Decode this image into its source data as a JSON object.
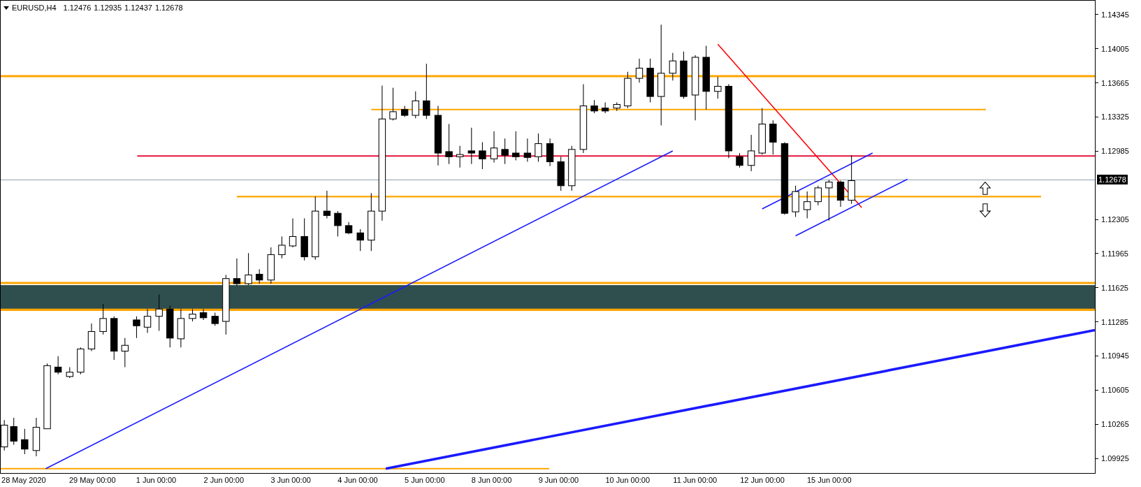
{
  "chart_header": {
    "symbol": "EURUSD,H4",
    "quotes": [
      "1.12476",
      "1.12935",
      "1.12437",
      "1.12678"
    ]
  },
  "price_axis": {
    "labels": [
      "1.14345",
      "1.14005",
      "1.13665",
      "1.13325",
      "1.12985",
      "1.12305",
      "1.11965",
      "1.11625",
      "1.11285",
      "1.10945",
      "1.10605",
      "1.10265",
      "1.09925"
    ],
    "current_price": "1.12678"
  },
  "time_axis": {
    "labels": [
      "28 May 2020",
      "29 May 00:00",
      "1 Jun 00:00",
      "2 Jun 00:00",
      "3 Jun 00:00",
      "4 Jun 00:00",
      "5 Jun 00:00",
      "8 Jun 00:00",
      "9 Jun 00:00",
      "10 Jun 00:00",
      "11 Jun 00:00",
      "12 Jun 00:00",
      "15 Jun 00:00"
    ]
  }
}
